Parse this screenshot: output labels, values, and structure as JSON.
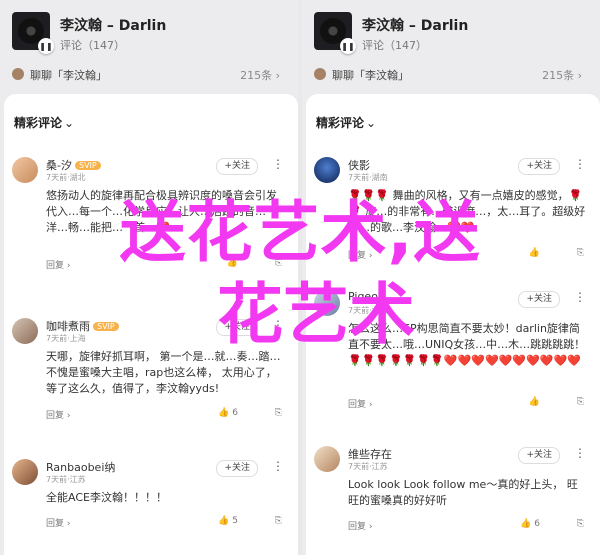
{
  "left": {
    "player": {
      "title": "李汶翰 – Darlin",
      "comments": "评论（147）"
    },
    "chat": {
      "text": "聊聊「李汶翰」",
      "online": "215条 ›"
    },
    "section": "精彩评论",
    "comments": [
      {
        "name": "桑-汐",
        "vip": "SVIP",
        "time": "7天前·湖北",
        "body": "悠扬动人的旋律再配合极具辨识度的嗓音会引发代入…每一个…化学反应…让人…活跃的音…洋…畅…能把…一首…❤️",
        "reply": "回复"
      },
      {
        "name": "咖啡煮雨",
        "vip": "SVIP",
        "time": "7天前·上海",
        "body": "天哪，旋律好抓耳啊， 第一个是…就…奏…踏…不愧是蜜嗓大主唱，rap也这么棒， 太用心了，等了这么久，值得了，李汶翰yyds!",
        "reply": "回复",
        "likes": "6"
      },
      {
        "name": "Ranbaobei纳",
        "time": "7天前·江苏",
        "body": "全能ACE李汶翰！！！！",
        "reply": "回复",
        "likes": "5"
      }
    ]
  },
  "right": {
    "player": {
      "title": "李汶翰 – Darlin",
      "comments": "评论（147）"
    },
    "chat": {
      "text": "聊聊「李汶翰」",
      "online": "215条 ›"
    },
    "section": "精彩评论",
    "comments": [
      {
        "name": "侠影",
        "time": "7天前·湖南",
        "body": "🌹🌹🌹 舞曲的风格，又有一点嬉皮的感觉，🌹🌹 旋…的非常有…辨识度…，太…耳了。超级好听…的歌…李汶翰…❤️❤️",
        "reply": "回复",
        "likes": ""
      },
      {
        "name": "Pigeon…",
        "time": "7天前·北京",
        "body": "怎么这么…EP构思简直不要太妙！darlin旋律简直不要太…哦…UNIQ女孩…中…木…跳跳跳跳！🌹🌹🌹🌹🌹🌹🌹❤️❤️❤️❤️❤️❤️❤️❤️❤️❤️",
        "reply": "回复"
      },
      {
        "name": "维些存在",
        "time": "7天前·江苏",
        "body": "Look look Look follow me～真的好上头， 旺旺的蜜嗓真的好好听",
        "reply": "回复",
        "likes": "6"
      }
    ]
  },
  "follow_label": "+关注",
  "overlay": {
    "line1": "送花艺术,送",
    "line2": "花艺术"
  }
}
